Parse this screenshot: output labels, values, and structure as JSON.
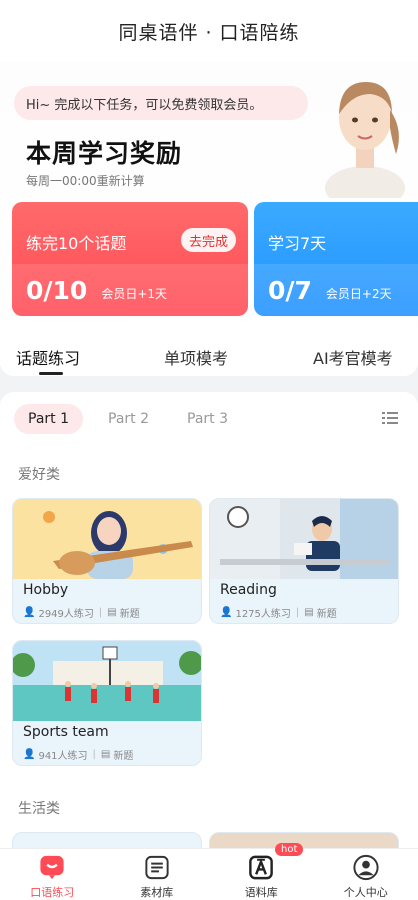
{
  "app": {
    "title": "同桌语伴 · 口语陪练"
  },
  "reward": {
    "bubble": "Hi~ 完成以下任务，可以免费领取会员。",
    "title": "本周学习奖励",
    "subtitle": "每周一00:00重新计算",
    "tasks": [
      {
        "label": "练完10个话题",
        "action": "去完成",
        "count": "0/10",
        "bonus": "会员日+1天",
        "progress": 0
      },
      {
        "label": "学习7天",
        "count": "0/7",
        "bonus": "会员日+2天",
        "progress": 0
      }
    ]
  },
  "main_tabs": [
    "话题练习",
    "单项模考",
    "AI考官模考"
  ],
  "parts": [
    "Part 1",
    "Part 2",
    "Part 3"
  ],
  "categories": [
    {
      "name": "爱好类",
      "topics": [
        {
          "name": "Hobby",
          "learners": "2949人练习",
          "tag": "新题"
        },
        {
          "name": "Reading",
          "learners": "1275人练习",
          "tag": "新题"
        },
        {
          "name": "Sports team",
          "learners": "941人练习",
          "tag": "新题"
        }
      ]
    },
    {
      "name": "生活类"
    }
  ],
  "bottom_nav": [
    {
      "label": "口语练习",
      "icon": "chat-icon"
    },
    {
      "label": "素材库",
      "icon": "library-icon"
    },
    {
      "label": "语料库",
      "icon": "corpus-icon",
      "badge": "hot"
    },
    {
      "label": "个人中心",
      "icon": "profile-icon"
    }
  ],
  "colors": {
    "accent": "#ff4b55",
    "blue": "#2292ff",
    "pink_bg": "#fde8ea"
  }
}
